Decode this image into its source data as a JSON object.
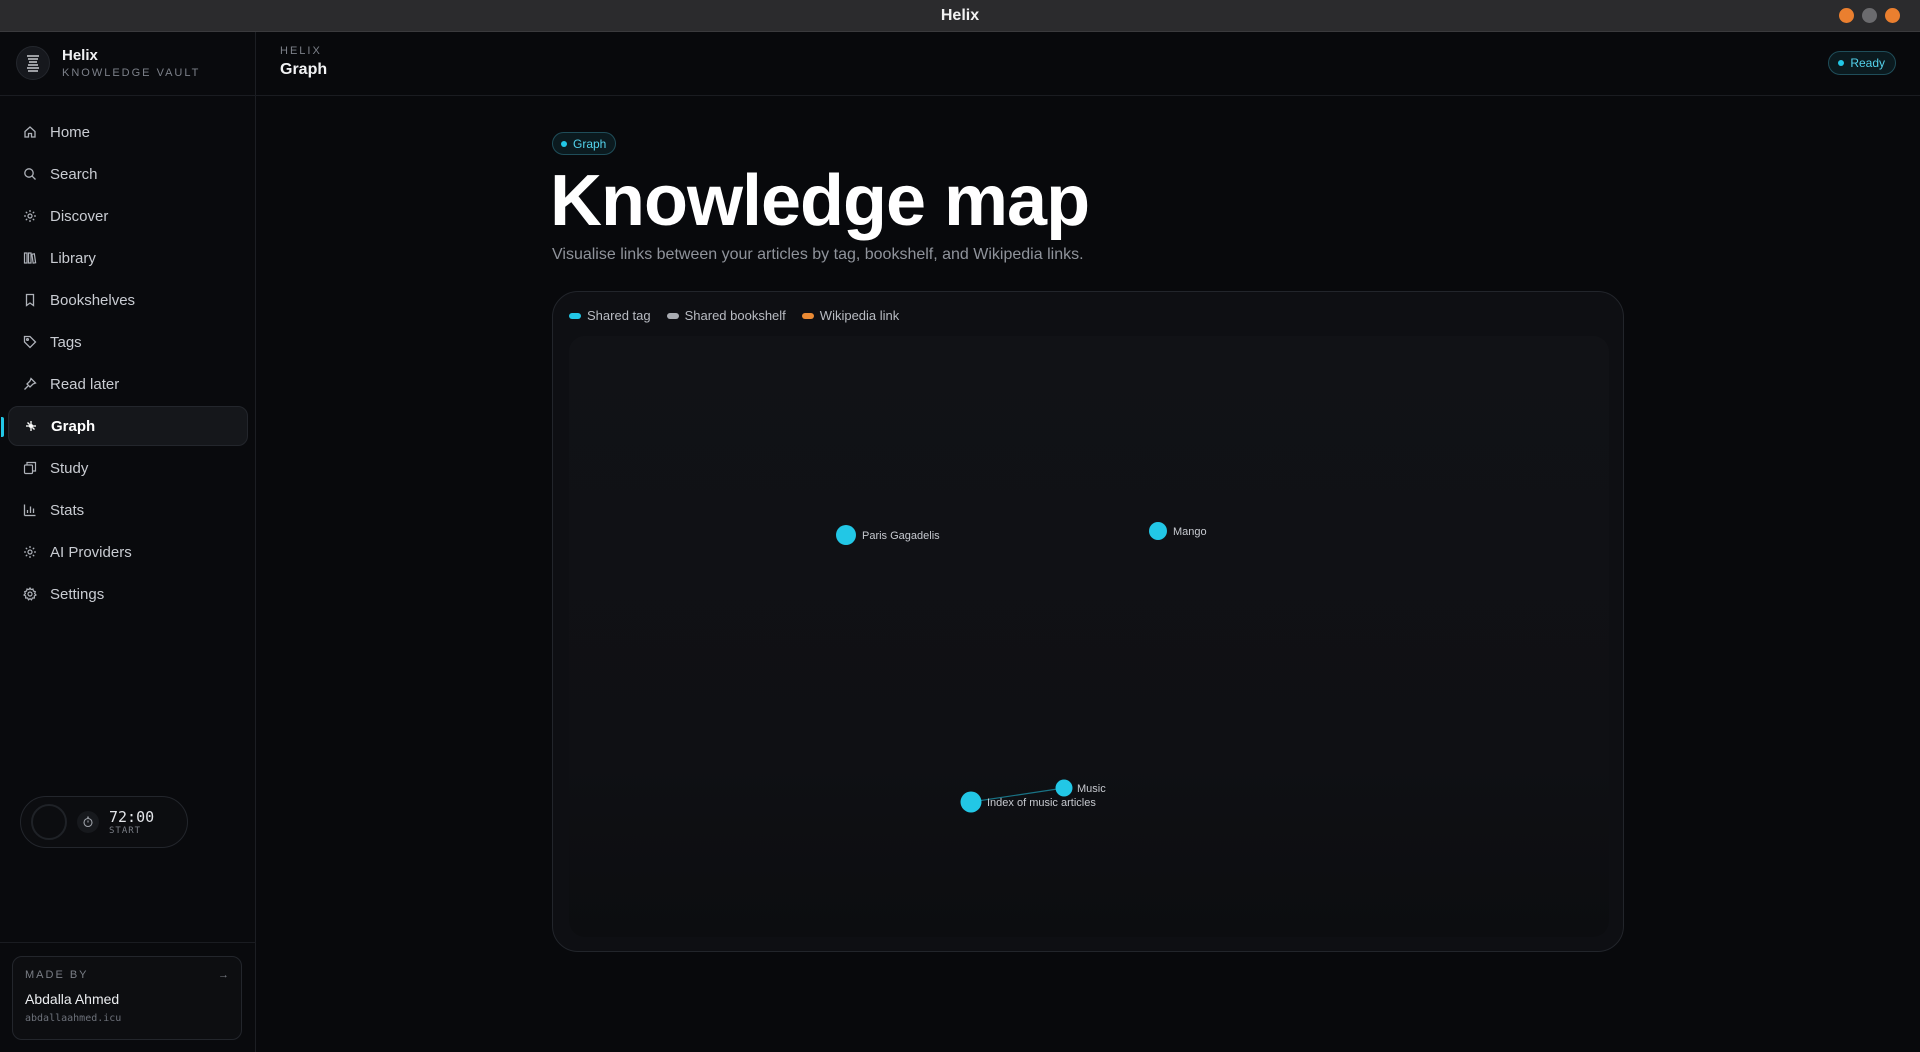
{
  "window": {
    "title": "Helix"
  },
  "brand": {
    "name": "Helix",
    "subtitle": "KNOWLEDGE VAULT"
  },
  "nav": {
    "items": [
      {
        "label": "Home",
        "icon": "home-icon"
      },
      {
        "label": "Search",
        "icon": "search-icon"
      },
      {
        "label": "Discover",
        "icon": "sparkle-icon"
      },
      {
        "label": "Library",
        "icon": "library-icon"
      },
      {
        "label": "Bookshelves",
        "icon": "bookmark-icon"
      },
      {
        "label": "Tags",
        "icon": "tag-icon"
      },
      {
        "label": "Read later",
        "icon": "pin-icon"
      },
      {
        "label": "Graph",
        "icon": "graph-icon",
        "active": true
      },
      {
        "label": "Study",
        "icon": "cards-icon"
      },
      {
        "label": "Stats",
        "icon": "bar-chart-icon"
      },
      {
        "label": "AI Providers",
        "icon": "sparkle-icon"
      },
      {
        "label": "Settings",
        "icon": "gear-icon"
      }
    ]
  },
  "timer": {
    "time": "72:00",
    "label": "START"
  },
  "made_by": {
    "label": "MADE BY",
    "name": "Abdalla Ahmed",
    "site": "abdallaahmed.icu"
  },
  "header": {
    "crumb": "HELIX",
    "title": "Graph",
    "status": "Ready"
  },
  "main": {
    "pill": "Graph",
    "title": "Knowledge map",
    "subtitle": "Visualise links between your articles by tag, bookshelf, and Wikipedia links."
  },
  "legend": [
    {
      "label": "Shared tag",
      "color": "#22c7e6"
    },
    {
      "label": "Shared bookshelf",
      "color": "#a9acb2"
    },
    {
      "label": "Wikipedia link",
      "color": "#ea8a34"
    }
  ],
  "graph": {
    "nodes": [
      {
        "id": "paris",
        "label": "Paris Gagadelis"
      },
      {
        "id": "mango",
        "label": "Mango"
      },
      {
        "id": "music",
        "label": "Music"
      },
      {
        "id": "index",
        "label": "Index of music articles"
      }
    ],
    "edges": [
      {
        "from": "index",
        "to": "music",
        "type": "Shared tag"
      }
    ]
  },
  "colors": {
    "accent": "#22c7e6",
    "background": "#08090c"
  }
}
